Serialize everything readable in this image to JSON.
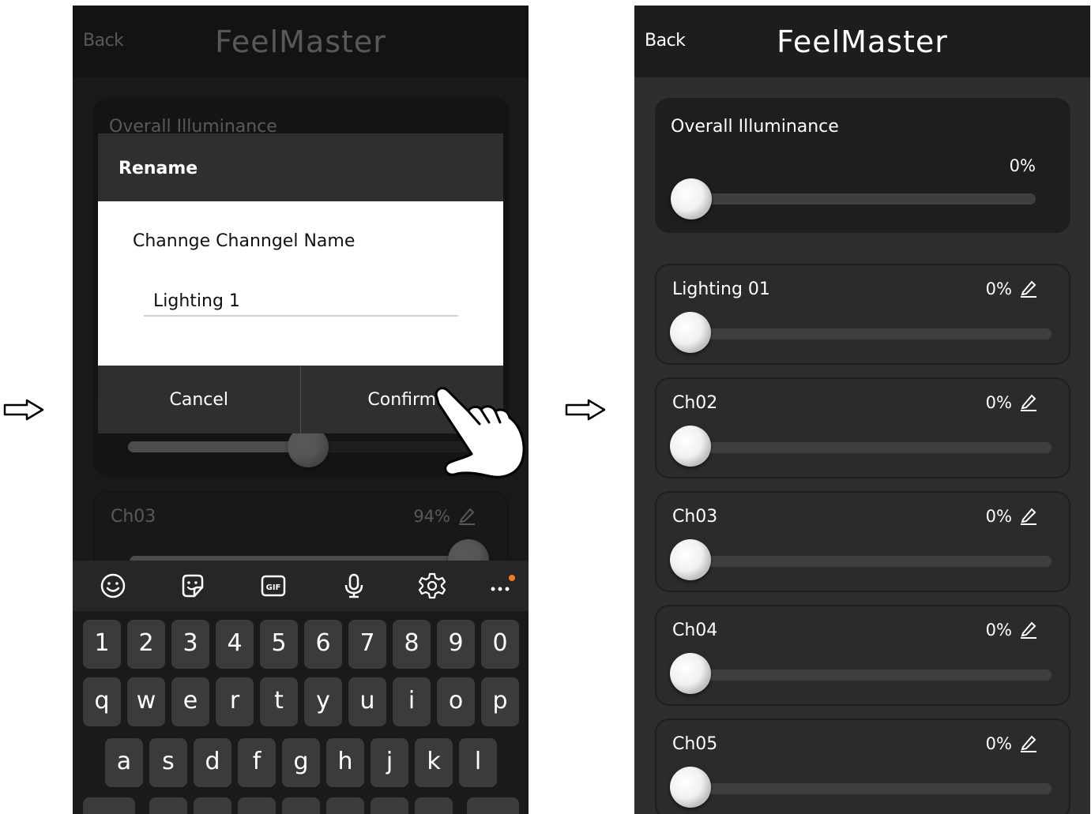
{
  "left_screen": {
    "header": {
      "back_label": "Back",
      "brand": "FeelMaster"
    },
    "overall_card": {
      "title": "Overall Illuminance"
    },
    "background_card": {
      "title": "Ch03",
      "percent": "94%",
      "value_fraction": 0.94
    },
    "partial_slider": {
      "value_fraction": 0.52
    },
    "dialog": {
      "title": "Rename",
      "label": "Channge Channgel Name",
      "input_value": "Lighting 1",
      "cancel_label": "Cancel",
      "confirm_label": "Confirm"
    },
    "keyboard": {
      "toolbar": [
        "emoji-icon",
        "sticker-icon",
        "gif-icon",
        "microphone-icon",
        "settings-icon",
        "more-icon"
      ],
      "row_numbers": [
        "1",
        "2",
        "3",
        "4",
        "5",
        "6",
        "7",
        "8",
        "9",
        "0"
      ],
      "row_top": [
        "q",
        "w",
        "e",
        "r",
        "t",
        "y",
        "u",
        "i",
        "o",
        "p"
      ],
      "row_middle": [
        "a",
        "s",
        "d",
        "f",
        "g",
        "h",
        "j",
        "k",
        "l"
      ]
    }
  },
  "right_screen": {
    "header": {
      "back_label": "Back",
      "brand": "FeelMaster"
    },
    "overall": {
      "title": "Overall Illuminance",
      "percent": "0%",
      "value_fraction": 0
    },
    "channels": [
      {
        "name": "Lighting 01",
        "percent": "0%",
        "value_fraction": 0
      },
      {
        "name": "Ch02",
        "percent": "0%",
        "value_fraction": 0
      },
      {
        "name": "Ch03",
        "percent": "0%",
        "value_fraction": 0
      },
      {
        "name": "Ch04",
        "percent": "0%",
        "value_fraction": 0
      },
      {
        "name": "Ch05",
        "percent": "0%",
        "value_fraction": 0
      }
    ]
  },
  "colors": {
    "screen_bg": "#2e2e30",
    "header_bg": "#1d1d1f",
    "card_bg": "#1e1e20",
    "accent": "#ffffff",
    "notify_dot": "#f07c2a"
  }
}
